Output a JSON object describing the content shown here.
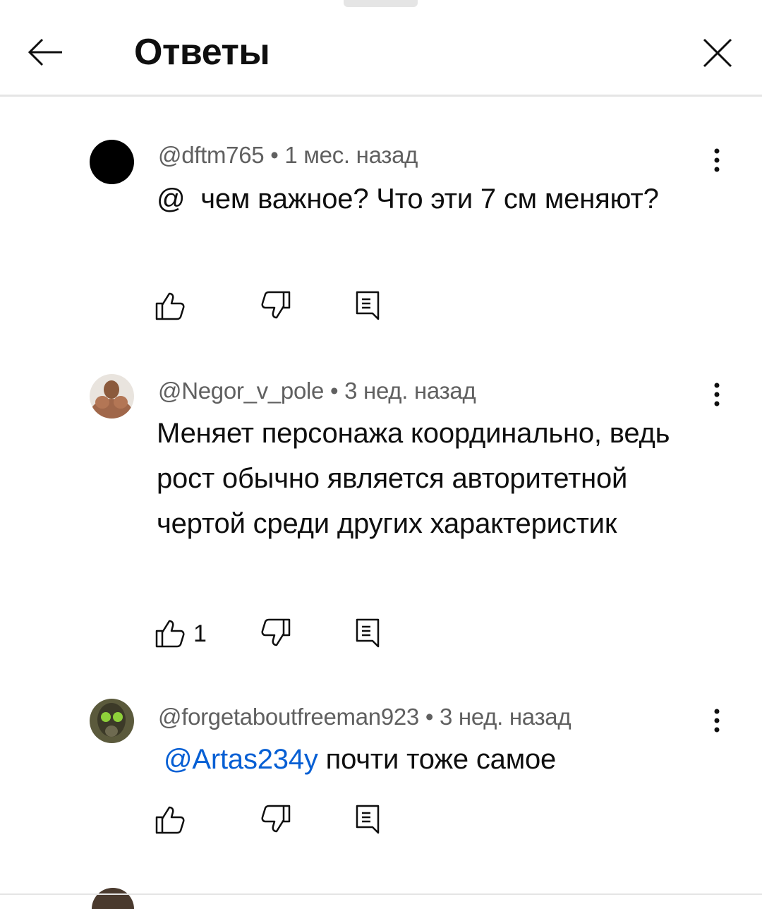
{
  "header": {
    "title": "Ответы"
  },
  "comments": [
    {
      "handle": "@dftm765",
      "separator": "•",
      "time": "1 мес. назад",
      "text_prefix": "@  ",
      "mention": "",
      "text": "чем важное? Что эти 7 см меняют?",
      "likes": "",
      "avatar_color": "#000000"
    },
    {
      "handle": "@Negor_v_pole",
      "separator": "•",
      "time": "3 нед. назад",
      "text_prefix": "",
      "mention": "",
      "text": "Меняет персонажа координально, ведь рост обычно является авторитетной чертой среди других характеристик",
      "likes": "1",
      "avatar_color": "#a0674a"
    },
    {
      "handle": "@forgetaboutfreeman923",
      "separator": "•",
      "time": "3 нед. назад",
      "text_prefix": "",
      "mention": "@Artas234y",
      "text": " почти тоже самое",
      "likes": "",
      "avatar_color": "#3c5a2a"
    }
  ],
  "icons": {
    "back": "arrow-left-icon",
    "close": "close-icon",
    "more": "more-vertical-icon",
    "like": "thumb-up-icon",
    "dislike": "thumb-down-icon",
    "reply": "reply-icon"
  },
  "colors": {
    "mention": "#065fd4",
    "meta": "#606060",
    "divider": "#e5e5e5"
  }
}
